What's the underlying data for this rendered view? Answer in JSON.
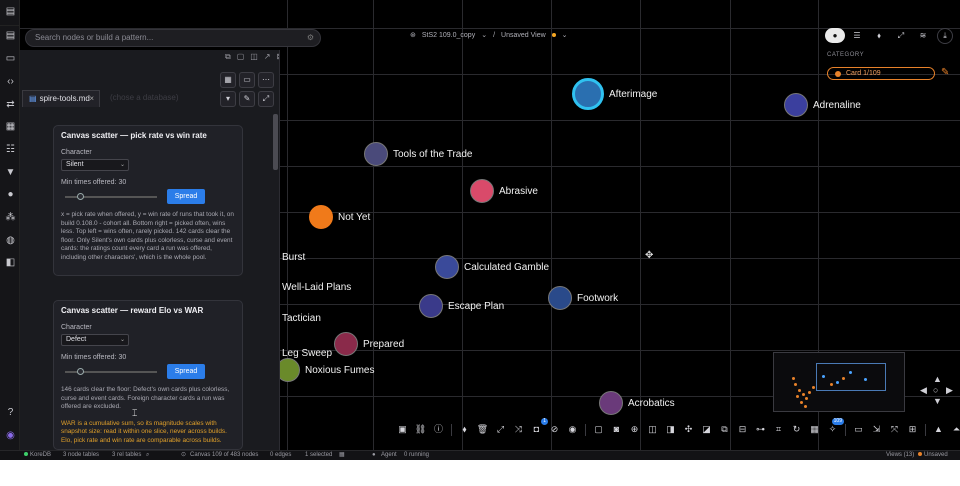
{
  "header": {
    "search_placeholder": "Search nodes or build a pattern...",
    "crumb_project": "StS2 109.0_copy",
    "crumb_view": "Unsaved View",
    "crumb_sep": "/"
  },
  "editor": {
    "file_tab": "spire-tools.md",
    "placeholder_tab": "(chose a database)"
  },
  "cards": [
    {
      "title": "Canvas scatter — pick rate vs win rate",
      "field_label": "Character",
      "select_value": "Silent",
      "slider_label": "Min times offered: 30",
      "button": "Spread",
      "desc": "x = pick rate when offered, y = win rate of runs that took it, on build 0.108.0 - cohort all. Bottom right = picked often, wins less. Top left = wins often, rarely picked. 142 cards clear the floor. Only Silent's own cards plus colorless, curse and event cards: the ratings count every card a run was offered, including other characters', which is the whole pool.",
      "warn": ""
    },
    {
      "title": "Canvas scatter — reward Elo vs WAR",
      "field_label": "Character",
      "select_value": "Defect",
      "slider_label": "Min times offered: 30",
      "button": "Spread",
      "desc": "146 cards clear the floor: Defect's own cards plus colorless, curse and event cards. Foreign character cards a run was offered are excluded.",
      "warn": "WAR is a cumulative sum, so its magnitude scales with snapshot size: read it within one slice, never across builds. Elo, pick rate and win rate are comparable across builds."
    }
  ],
  "nodes": [
    {
      "label": "Afterimage",
      "color": "#2a6fb0"
    },
    {
      "label": "Adrenaline",
      "color": "#3b3f9e"
    },
    {
      "label": "Tools of the Trade",
      "color": "#4a4a7a"
    },
    {
      "label": "Abrasive",
      "color": "#d94a6a"
    },
    {
      "label": "Not Yet",
      "color": "#f07a1a"
    },
    {
      "label": "Burst",
      "color": "#5a5a2a"
    },
    {
      "label": "Calculated Gamble",
      "color": "#3a4a9a"
    },
    {
      "label": "Well-Laid Plans",
      "color": "#3a3a3a"
    },
    {
      "label": "Footwork",
      "color": "#2a4a8a"
    },
    {
      "label": "Escape Plan",
      "color": "#3a3a8a"
    },
    {
      "label": "Tactician",
      "color": "#3a3a3a"
    },
    {
      "label": "Prepared",
      "color": "#8a2a4a"
    },
    {
      "label": "Leg Sweep",
      "color": "#3a5a2a"
    },
    {
      "label": "Noxious Fumes",
      "color": "#6a8a2a"
    },
    {
      "label": "Acrobatics",
      "color": "#6a3a7a"
    }
  ],
  "properties": {
    "category_label": "CATEGORY",
    "chip": "Card 1/109"
  },
  "toolbar": {
    "badge1": "1",
    "badge2": "109"
  },
  "status": {
    "db": "KoreDB",
    "node_tables": "3 node tables",
    "rel_tables": "3 rel tables",
    "canvas": "Canvas",
    "canvas_count": "109 of 483 nodes",
    "edges": "0 edges",
    "selected": "1 selected",
    "agent": "Agent",
    "agent_state": "0 running",
    "views": "Views (13)",
    "unsaved": "Unsaved"
  },
  "colors": {
    "accent": "#2b7de9",
    "brand_orange": "#e8822a",
    "status_green": "#3ecf6a"
  }
}
